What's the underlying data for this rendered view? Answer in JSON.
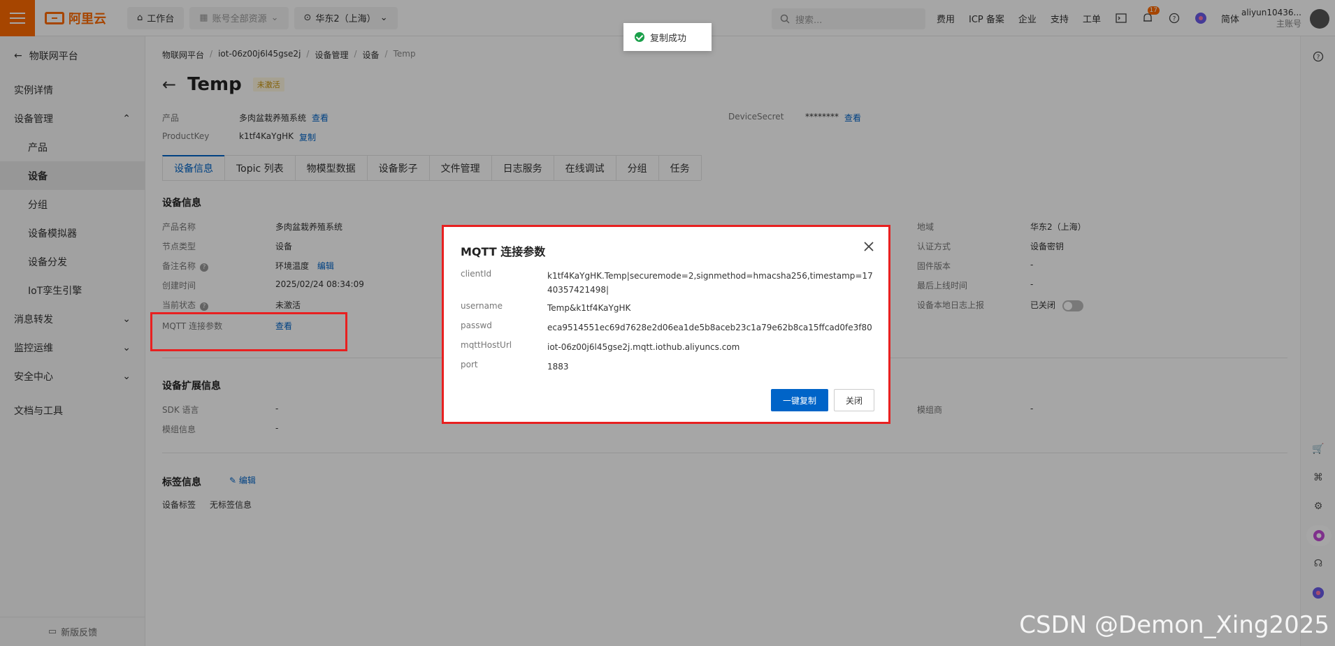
{
  "topbar": {
    "logo_text": "阿里云",
    "workbench": "工作台",
    "account_resources": "账号全部资源",
    "region": "华东2（上海）",
    "search_placeholder": "搜索...",
    "links": [
      "费用",
      "ICP 备案",
      "企业",
      "支持",
      "工单"
    ],
    "notification_count": "17",
    "lang": "简体",
    "user_name": "aliyun10436...",
    "user_role": "主账号"
  },
  "sidebar": {
    "back_label": "物联网平台",
    "items": [
      {
        "label": "实例详情",
        "type": "item"
      },
      {
        "label": "设备管理",
        "type": "group",
        "expanded": true
      },
      {
        "label": "产品",
        "type": "sub"
      },
      {
        "label": "设备",
        "type": "sub",
        "active": true
      },
      {
        "label": "分组",
        "type": "sub"
      },
      {
        "label": "设备模拟器",
        "type": "sub"
      },
      {
        "label": "设备分发",
        "type": "sub"
      },
      {
        "label": "IoT孪生引擎",
        "type": "sub"
      },
      {
        "label": "消息转发",
        "type": "group"
      },
      {
        "label": "监控运维",
        "type": "group"
      },
      {
        "label": "安全中心",
        "type": "group"
      },
      {
        "label": "文档与工具",
        "type": "item"
      }
    ],
    "feedback": "新版反馈"
  },
  "breadcrumb": [
    "物联网平台",
    "iot-06z00j6l45gse2j",
    "设备管理",
    "设备",
    "Temp"
  ],
  "device": {
    "name": "Temp",
    "status_tag": "未激活",
    "product_label": "产品",
    "product_value": "多肉盆栽养殖系统",
    "view_link": "查看",
    "productkey_label": "ProductKey",
    "productkey_value": "k1tf4KaYgHK",
    "copy_link": "复制",
    "devicesecret_label": "DeviceSecret",
    "devicesecret_value": "********",
    "devicesecret_view": "查看"
  },
  "tabs": [
    "设备信息",
    "Topic 列表",
    "物模型数据",
    "设备影子",
    "文件管理",
    "日志服务",
    "在线调试",
    "分组",
    "任务"
  ],
  "info": {
    "section_title": "设备信息",
    "left": [
      {
        "k": "产品名称",
        "v": "多肉盆栽养殖系统"
      },
      {
        "k": "节点类型",
        "v": "设备"
      },
      {
        "k": "备注名称",
        "v": "环境温度",
        "link": "编辑",
        "help": true
      },
      {
        "k": "创建时间",
        "v": "2025/02/24 08:34:09"
      },
      {
        "k": "当前状态",
        "v": "未激活",
        "help": true
      },
      {
        "k": "MQTT 连接参数",
        "v": "",
        "link": "查看"
      }
    ],
    "right": [
      {
        "k": "地域",
        "v": "华东2（上海）"
      },
      {
        "k": "认证方式",
        "v": "设备密钥"
      },
      {
        "k": "固件版本",
        "v": "-"
      },
      {
        "k": "最后上线时间",
        "v": "-"
      },
      {
        "k": "设备本地日志上报",
        "v": "已关闭"
      }
    ]
  },
  "ext": {
    "section_title": "设备扩展信息",
    "rows": [
      {
        "k": "SDK 语言",
        "v": "-"
      },
      {
        "k": "模组信息",
        "v": "-"
      }
    ],
    "right_k": "模组商",
    "right_v": "-"
  },
  "tags": {
    "section_title": "标签信息",
    "edit": "编辑",
    "label": "设备标签",
    "value": "无标签信息"
  },
  "modal": {
    "title": "MQTT 连接参数",
    "rows": [
      {
        "k": "clientId",
        "v": "k1tf4KaYgHK.Temp|securemode=2,signmethod=hmacsha256,timestamp=1740357421498|"
      },
      {
        "k": "username",
        "v": "Temp&k1tf4KaYgHK"
      },
      {
        "k": "passwd",
        "v": "eca9514551ec69d7628e2d06ea1de5b8aceb23c1a79e62b8ca15ffcad0fe3f80"
      },
      {
        "k": "mqttHostUrl",
        "v": "iot-06z00j6l45gse2j.mqtt.iothub.aliyuncs.com"
      },
      {
        "k": "port",
        "v": "1883"
      }
    ],
    "copy_all": "一键复制",
    "close": "关闭"
  },
  "toast": "复制成功",
  "watermark": "CSDN @Demon_Xing2025",
  "colors": {
    "brand": "#ff6a00",
    "primary": "#0064c8",
    "highlight": "#e82020",
    "success": "#1aa04a"
  }
}
